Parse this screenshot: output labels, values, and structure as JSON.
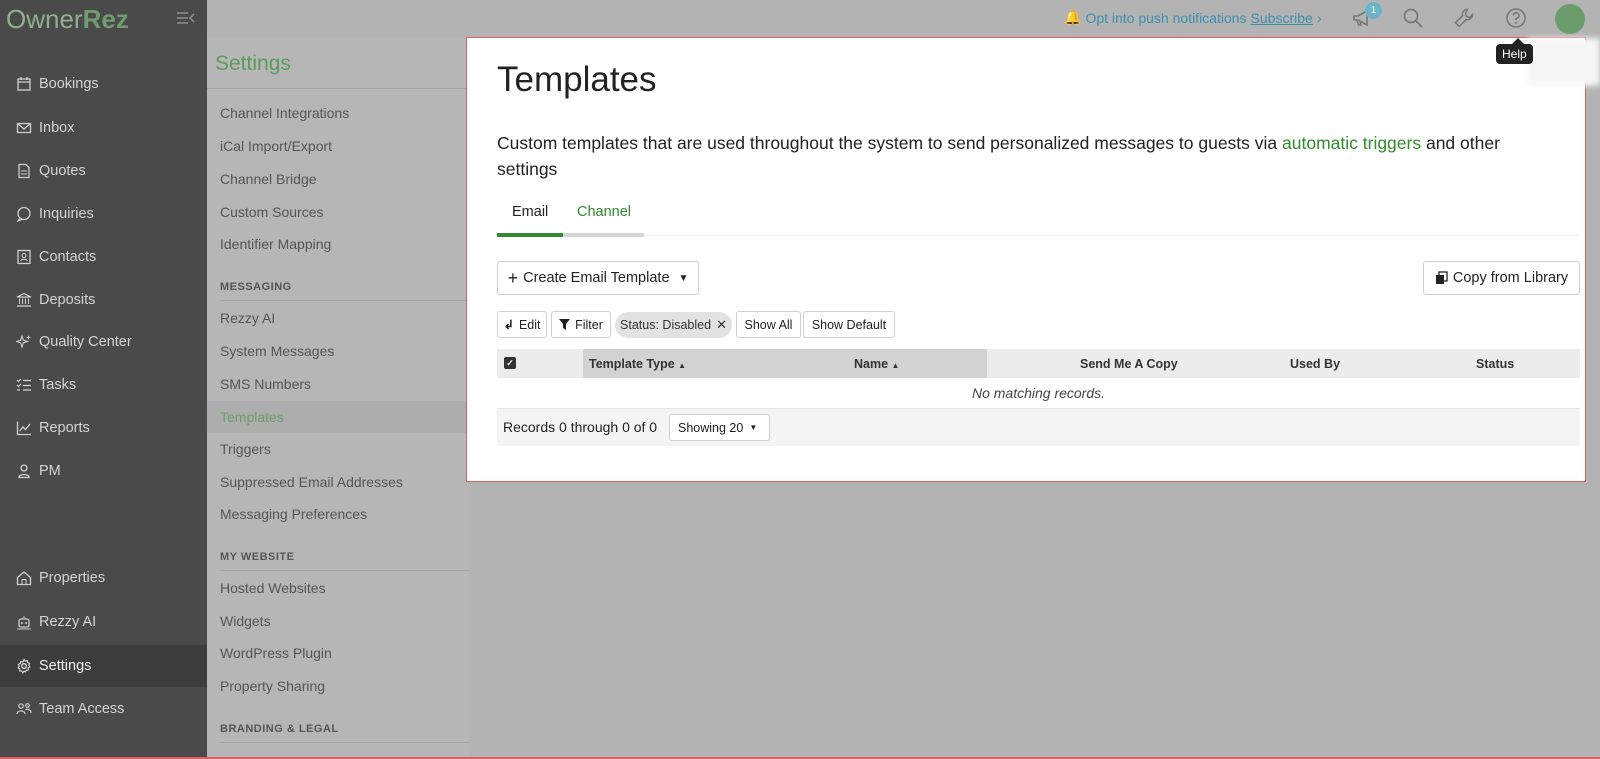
{
  "brand": {
    "part1": "Owner",
    "part2": "Rez"
  },
  "leftnav": {
    "items": [
      {
        "label": "Bookings",
        "icon": "calendar-icon"
      },
      {
        "label": "Inbox",
        "icon": "envelope-icon"
      },
      {
        "label": "Quotes",
        "icon": "document-icon"
      },
      {
        "label": "Inquiries",
        "icon": "chat-bubble-icon"
      },
      {
        "label": "Contacts",
        "icon": "contact-card-icon"
      },
      {
        "label": "Deposits",
        "icon": "bank-icon"
      },
      {
        "label": "Quality Center",
        "icon": "sparkle-icon"
      },
      {
        "label": "Tasks",
        "icon": "checklist-icon"
      },
      {
        "label": "Reports",
        "icon": "line-chart-icon"
      },
      {
        "label": "PM",
        "icon": "user-icon"
      }
    ],
    "bottom_items": [
      {
        "label": "Properties",
        "icon": "house-icon"
      },
      {
        "label": "Rezzy AI",
        "icon": "ai-robot-icon"
      },
      {
        "label": "Settings",
        "icon": "gear-icon"
      },
      {
        "label": "Team Access",
        "icon": "team-icon"
      }
    ]
  },
  "topbar": {
    "notify_text": "Opt into push notifications",
    "subscribe": "Subscribe",
    "badge_count": "1",
    "help_tooltip": "Help"
  },
  "settings": {
    "title": "Settings",
    "group1": [
      "Channel Integrations",
      "iCal Import/Export",
      "Channel Bridge",
      "Custom Sources",
      "Identifier Mapping"
    ],
    "messaging_header": "MESSAGING",
    "messaging": [
      "Rezzy AI",
      "System Messages",
      "SMS Numbers",
      "Templates",
      "Triggers",
      "Suppressed Email Addresses",
      "Messaging Preferences"
    ],
    "website_header": "MY WEBSITE",
    "website": [
      "Hosted Websites",
      "Widgets",
      "WordPress Plugin",
      "Property Sharing"
    ],
    "branding_header": "BRANDING & LEGAL"
  },
  "panel": {
    "title": "Templates",
    "desc_before": "Custom templates that are used throughout the system to send personalized messages to guests via ",
    "desc_link": "automatic triggers",
    "desc_after": " and other settings",
    "tabs": [
      "Email",
      "Channel"
    ],
    "create_button": "Create Email Template",
    "copy_button": "Copy from Library",
    "edit_button": "Edit",
    "filter_button": "Filter",
    "status_chip": "Status: Disabled",
    "show_all": "Show All",
    "show_default": "Show Default",
    "columns": [
      "Template Type",
      "Name",
      "Send Me A Copy",
      "Used By",
      "Status"
    ],
    "empty_text": "No matching records.",
    "records_text": "Records 0 through 0 of 0",
    "showing_select": "Showing 20"
  }
}
